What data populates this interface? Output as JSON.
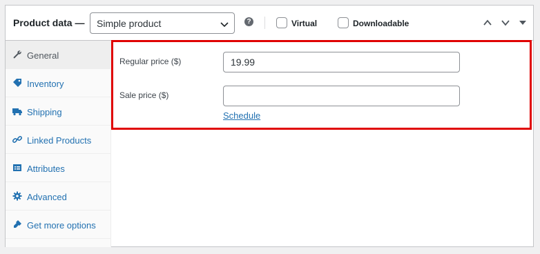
{
  "header": {
    "title": "Product data —",
    "product_type": "Simple product",
    "help_glyph": "?",
    "virtual_label": "Virtual",
    "downloadable_label": "Downloadable"
  },
  "sidebar": {
    "items": [
      {
        "label": "General",
        "icon": "wrench-icon",
        "active": true
      },
      {
        "label": "Inventory",
        "icon": "tag-icon",
        "active": false
      },
      {
        "label": "Shipping",
        "icon": "truck-icon",
        "active": false
      },
      {
        "label": "Linked Products",
        "icon": "link-icon",
        "active": false
      },
      {
        "label": "Attributes",
        "icon": "list-icon",
        "active": false
      },
      {
        "label": "Advanced",
        "icon": "gear-icon",
        "active": false
      },
      {
        "label": "Get more options",
        "icon": "plugin-icon",
        "active": false
      }
    ]
  },
  "general": {
    "regular_price_label": "Regular price ($)",
    "regular_price_value": "19.99",
    "sale_price_label": "Sale price ($)",
    "sale_price_value": "",
    "schedule_link": "Schedule"
  },
  "colors": {
    "link": "#2271b1",
    "highlight": "#e00000",
    "border": "#c3c4c7"
  }
}
